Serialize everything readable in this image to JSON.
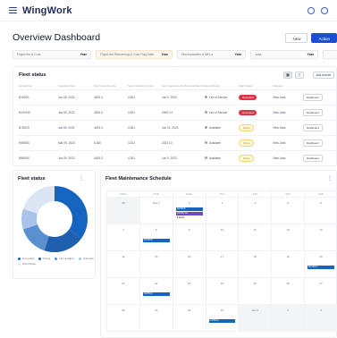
{
  "brand": {
    "name": "WingWork"
  },
  "colors": {
    "accent": "#1d4ed8",
    "event_blue": "#1565c0",
    "event_purple": "#7048c8",
    "alert_red": "#dc3545",
    "warn_yellow": "#f2d56b"
  },
  "header": {
    "title": "Overview Dashboard",
    "buttons": [
      "New",
      "Action"
    ]
  },
  "filters": [
    {
      "label": "Flight Hrs & Cost",
      "tag": "Year",
      "warn": false
    },
    {
      "label": "Flight Hrs Remaining & Cost Flag Date",
      "tag": "Year",
      "warn": true
    },
    {
      "label": "Discrepancies & MELs",
      "tag": "Year",
      "warn": false
    },
    {
      "label": "Jobs",
      "tag": "Year",
      "warn": false
    },
    {
      "label": "",
      "tag": "Y",
      "warn": false
    }
  ],
  "fleet": {
    "title": "Fleet status",
    "view_icons": [
      "grid-icon",
      "list-icon"
    ],
    "add_label": "Add Aircraft",
    "columns": [
      "Aircraft Reg",
      "Inspection Date",
      "Next Inspection Hrs",
      "Next Inspection Cycles",
      "Next Inspection Hrs Remaining",
      "Next Due",
      "Airworthiness",
      "Flight Status",
      "Assigned",
      ""
    ],
    "rows": [
      {
        "reg": "N1920S",
        "date": "Jun 08, 2023",
        "hrs": "4493.3",
        "cycles": "4,361",
        "remaining": "Jun 9, 2023",
        "due": "",
        "air": "Out of Service",
        "status": "Grounded",
        "status_type": "red",
        "assigned": "View Jobs",
        "action": "Dashboard"
      },
      {
        "reg": "N190YW",
        "date": "Jun 09, 2023",
        "hrs": "4493.3",
        "cycles": "4,361",
        "remaining": "0000 0 0",
        "due": "",
        "air": "Out of Service",
        "status": "Grounded",
        "status_type": "red",
        "assigned": "View Jobs",
        "action": "Dashboard"
      },
      {
        "reg": "N780CS",
        "date": "Jun 09, 2023",
        "hrs": "4493.3",
        "cycles": "4,361",
        "remaining": "Jun 24, 2023",
        "due": "",
        "air": "Available",
        "status": "Flying",
        "status_type": "yellow",
        "assigned": "View Jobs",
        "action": "Dashboard"
      },
      {
        "reg": "N985SS",
        "date": "Mar 09, 2023",
        "hrs": "6,180",
        "cycles": "3,232",
        "remaining": "2023 10",
        "due": "",
        "air": "Available",
        "status": "Flying",
        "status_type": "yellow",
        "assigned": "View Jobs",
        "action": "Dashboard"
      },
      {
        "reg": "N980SS",
        "date": "Jun 09, 2023",
        "hrs": "4493.3",
        "cycles": "4,361",
        "remaining": "Jun 9, 2023",
        "due": "",
        "air": "Available",
        "status": "Flying",
        "status_type": "yellow",
        "assigned": "View Jobs",
        "action": "Dashboard"
      }
    ]
  },
  "status_card": {
    "title": "Fleet status",
    "donut": [
      {
        "name": "Grounded",
        "value": 35,
        "color": "#1565c0"
      },
      {
        "name": "Flying",
        "value": 20,
        "color": "#1e5fae"
      },
      {
        "name": "Not updated",
        "value": 15,
        "color": "#5a8fd0"
      },
      {
        "name": "Unknown",
        "value": 10,
        "color": "#a9c4e8"
      },
      {
        "name": "AOG Mode",
        "value": 20,
        "color": "#dbe6f4"
      }
    ],
    "legend": [
      "Grounded",
      "Flying",
      "Not updated",
      "Unknown",
      "AOG Mode"
    ]
  },
  "schedule": {
    "title": "Fleet Maintenance Schedule",
    "weekdays": [
      "MON",
      "TUE",
      "WED",
      "THU",
      "FRI",
      "SAT",
      "SUN"
    ],
    "weeks": [
      [
        "28",
        "Dec 1",
        "2",
        "3",
        "4",
        "5",
        "6"
      ],
      [
        "7",
        "8",
        "9",
        "10",
        "11",
        "12",
        "13"
      ],
      [
        "14",
        "15",
        "16",
        "17",
        "18",
        "19",
        "20"
      ],
      [
        "21",
        "22",
        "23",
        "24",
        "25",
        "26",
        "27"
      ],
      [
        "28",
        "29",
        "30",
        "31",
        "Jan 1",
        "2",
        "3"
      ]
    ],
    "muted": [
      [
        0,
        0
      ],
      [
        4,
        4
      ],
      [
        4,
        5
      ],
      [
        4,
        6
      ]
    ],
    "events": [
      {
        "week": 0,
        "day": 2,
        "slot": 0,
        "label": "N178CS",
        "color": "blue"
      },
      {
        "week": 0,
        "day": 2,
        "slot": 1,
        "label": "N178S Ins",
        "color": "purple"
      },
      {
        "week": 0,
        "day": 2,
        "slot": 2,
        "label": "2 more",
        "color": "note"
      },
      {
        "week": 1,
        "day": 1,
        "slot": 1,
        "label": "N178CS",
        "color": "blue"
      },
      {
        "week": 2,
        "day": 6,
        "slot": 1,
        "label": "N178CS",
        "color": "blue"
      },
      {
        "week": 3,
        "day": 1,
        "slot": 1,
        "label": "N178CS",
        "color": "blue"
      },
      {
        "week": 4,
        "day": 3,
        "slot": 1,
        "label": "N178CS",
        "color": "blue"
      }
    ]
  }
}
